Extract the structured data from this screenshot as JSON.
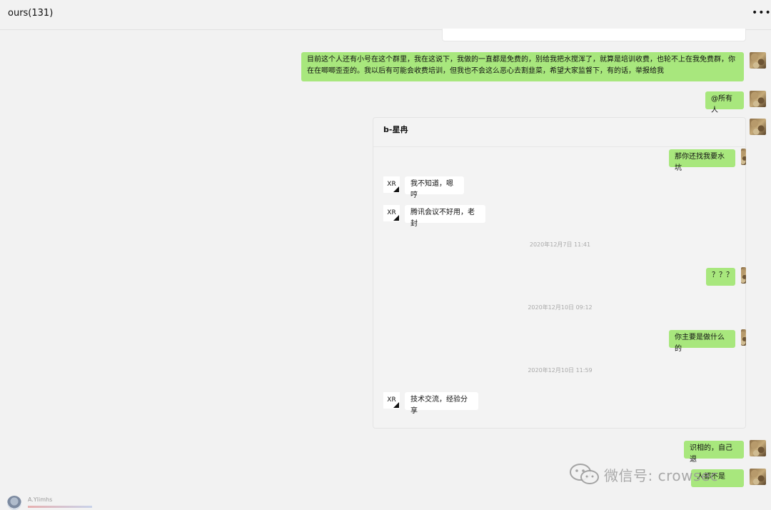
{
  "header": {
    "title": "ours(131)",
    "more_label": "•••"
  },
  "messages": [
    {
      "text": "目前这个人还有小号在这个群里，我在这说下，我做的一直都是免费的，别给我把水搅浑了，就算是培训收费，也轮不上在我免费群，你在在唧唧歪歪的。我以后有可能会收费培训，但我也不会这么恶心去割韭菜，希望大家监督下，有的话，举报给我"
    },
    {
      "text": "@所有人"
    },
    {
      "text": "识相的，自己退"
    },
    {
      "text": "人都不是"
    }
  ],
  "forwarded": {
    "title": "b-星冉",
    "items": [
      {
        "text": "那你还找我要水坑"
      },
      {
        "avatar": "XR",
        "text": "我不知道，嗯哼"
      },
      {
        "avatar": "XR",
        "text": "腾讯会议不好用，老封"
      },
      {
        "text": "？？？"
      },
      {
        "text": "你主要是做什么的"
      },
      {
        "avatar": "XR",
        "text": "技术交流，经验分享"
      }
    ],
    "timestamps": [
      "2020年12月7日 11:41",
      "2020年12月10日 09:12",
      "2020年12月10日 11:59"
    ]
  },
  "watermark": {
    "text": "微信号: crowsec",
    "icon": "wechat-icon"
  },
  "bottom": {
    "name": "A.Ylimhs"
  }
}
